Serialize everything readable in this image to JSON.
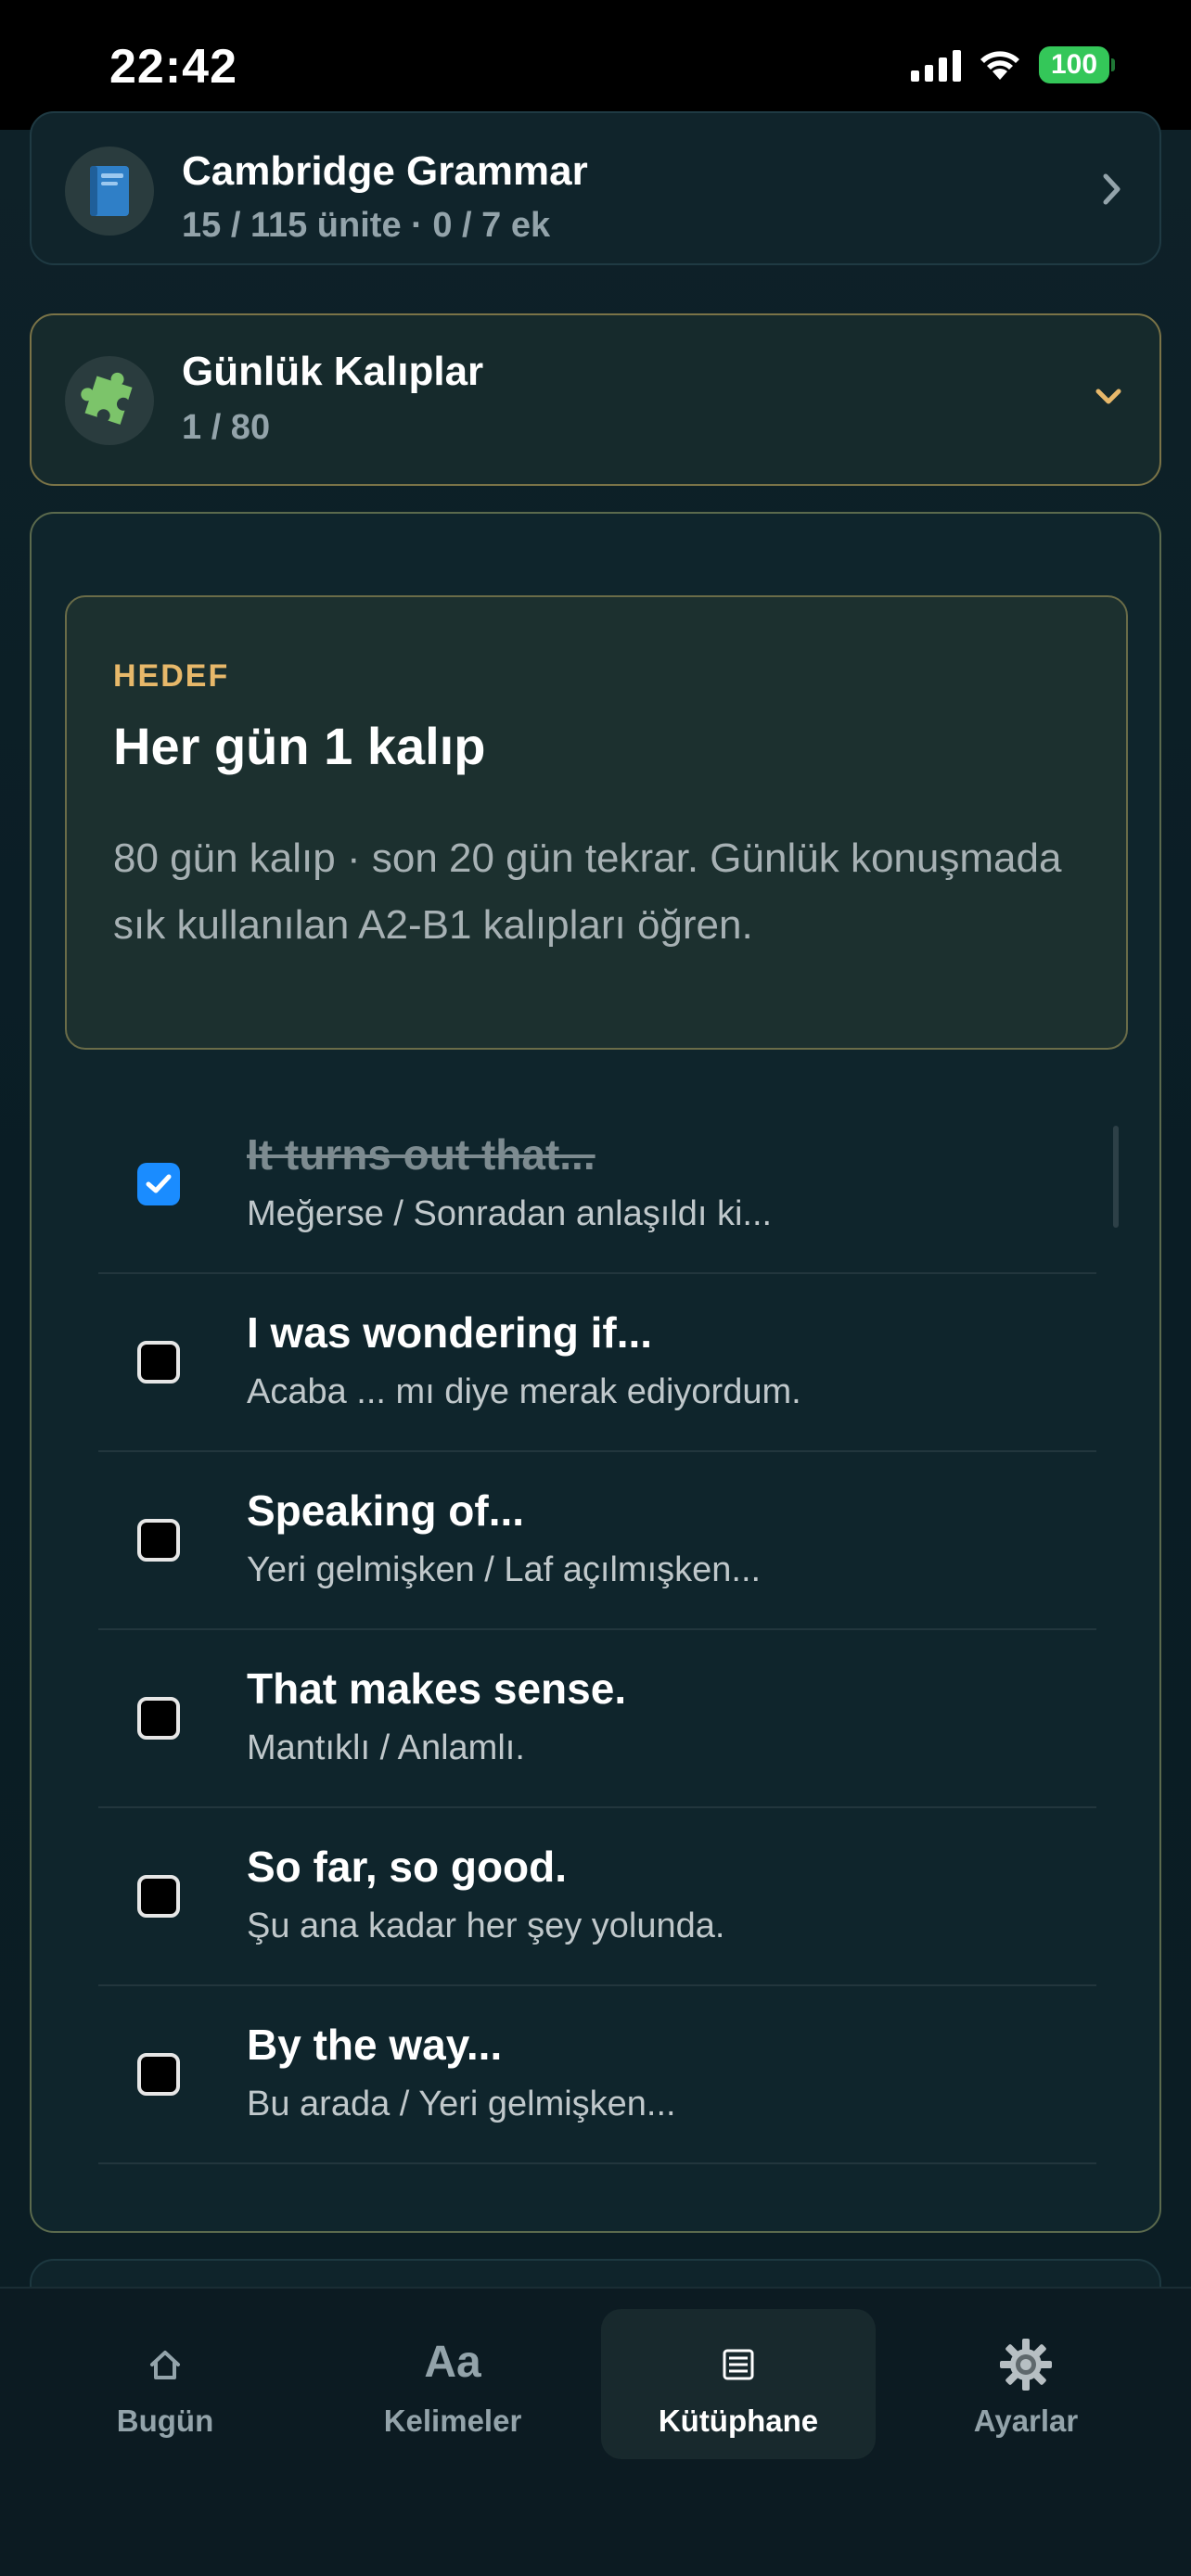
{
  "status_bar": {
    "time": "22:42",
    "battery": "100"
  },
  "library": {
    "cambridge": {
      "title": "Cambridge Grammar",
      "subtitle": "15 / 115 ünite · 0 / 7 ek",
      "icon": "blue-book-icon"
    },
    "gunluk": {
      "title": "Günlük Kalıplar",
      "subtitle": "1 / 80",
      "icon": "puzzle-piece-icon"
    }
  },
  "goal": {
    "label": "HEDEF",
    "title": "Her gün 1 kalıp",
    "description": "80 gün kalıp · son 20 gün tekrar. Günlük konuşmada sık kullanılan A2-B1 kalıpları öğren."
  },
  "patterns": [
    {
      "title": "It turns out that...",
      "meaning": "Meğerse / Sonradan anlaşıldı ki...",
      "done": true
    },
    {
      "title": "I was wondering if...",
      "meaning": "Acaba ... mı diye merak ediyordum.",
      "done": false
    },
    {
      "title": "Speaking of...",
      "meaning": "Yeri gelmişken / Laf açılmışken...",
      "done": false
    },
    {
      "title": "That makes sense.",
      "meaning": "Mantıklı / Anlamlı.",
      "done": false
    },
    {
      "title": "So far, so good.",
      "meaning": "Şu ana kadar her şey yolunda.",
      "done": false
    },
    {
      "title": "By the way...",
      "meaning": "Bu arada / Yeri gelmişken...",
      "done": false
    }
  ],
  "tabs": [
    {
      "label": "Bugün",
      "icon": "home-icon",
      "glyph": "⌂",
      "active": false
    },
    {
      "label": "Kelimeler",
      "icon": "text-aa-icon",
      "glyph": "Aa",
      "active": false
    },
    {
      "label": "Kütüphane",
      "icon": "library-icon",
      "glyph": "",
      "active": true
    },
    {
      "label": "Ayarlar",
      "icon": "gear-icon",
      "glyph": "",
      "active": false
    }
  ],
  "colors": {
    "accent_gold": "#e7b86a",
    "checkbox_blue": "#1a8cff",
    "battery_green": "#34c759"
  }
}
